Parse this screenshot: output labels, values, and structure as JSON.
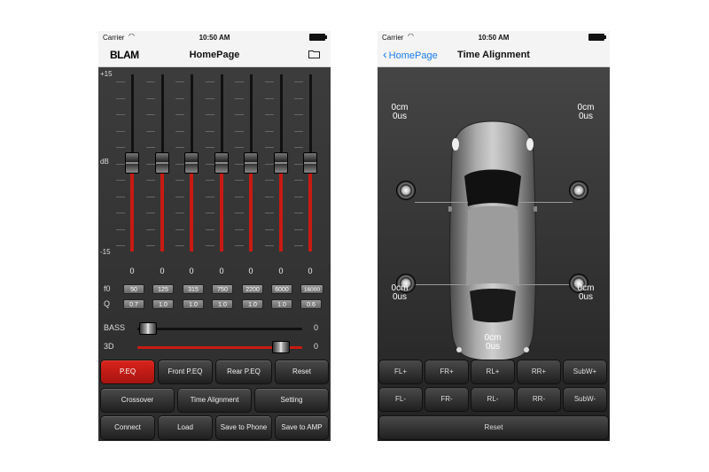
{
  "left_phone": {
    "status": {
      "carrier": "Carrier",
      "time": "10:50 AM"
    },
    "nav": {
      "brand": "BLAM",
      "title": "HomePage"
    },
    "scale": {
      "top": "+15",
      "mid": "dB",
      "bottom": "-15"
    },
    "eq_bands": [
      {
        "gain": "0",
        "f0": "50",
        "q": "0.7"
      },
      {
        "gain": "0",
        "f0": "125",
        "q": "1.0"
      },
      {
        "gain": "0",
        "f0": "315",
        "q": "1.0"
      },
      {
        "gain": "0",
        "f0": "750",
        "q": "1.0"
      },
      {
        "gain": "0",
        "f0": "2200",
        "q": "1.0"
      },
      {
        "gain": "0",
        "f0": "6000",
        "q": "1.0"
      },
      {
        "gain": "0",
        "f0": "16000",
        "q": "0.6"
      }
    ],
    "param_labels": {
      "f0": "f0",
      "q": "Q"
    },
    "bass": {
      "label": "BASS",
      "value": "0",
      "level": 0
    },
    "three_d": {
      "label": "3D",
      "value": "0",
      "level": 1
    },
    "buttons": {
      "row1": [
        "P.EQ",
        "Front P.EQ",
        "Rear P.EQ",
        "Reset"
      ],
      "row2": [
        "Crossover",
        "Time Alignment",
        "Setting"
      ],
      "row3": [
        "Connect",
        "Load",
        "Save to Phone",
        "Save to AMP"
      ]
    },
    "active_button": "P.EQ",
    "accent_color": "#c81a12"
  },
  "right_phone": {
    "status": {
      "carrier": "Carrier",
      "time": "10:50 AM"
    },
    "nav": {
      "back": "HomePage",
      "title": "Time Alignment"
    },
    "readouts": {
      "front_left": {
        "cm": "0cm",
        "us": "0us"
      },
      "front_right": {
        "cm": "0cm",
        "us": "0us"
      },
      "rear_left": {
        "cm": "0cm",
        "us": "0us"
      },
      "rear_right": {
        "cm": "0cm",
        "us": "0us"
      },
      "sub": {
        "cm": "0cm",
        "us": "0us"
      }
    },
    "buttons": {
      "plus": [
        "FL+",
        "FR+",
        "RL+",
        "RR+",
        "SubW+"
      ],
      "minus": [
        "FL-",
        "FR-",
        "RL-",
        "RR-",
        "SubW-"
      ],
      "reset": "Reset"
    },
    "back_color": "#1a7cf0"
  }
}
